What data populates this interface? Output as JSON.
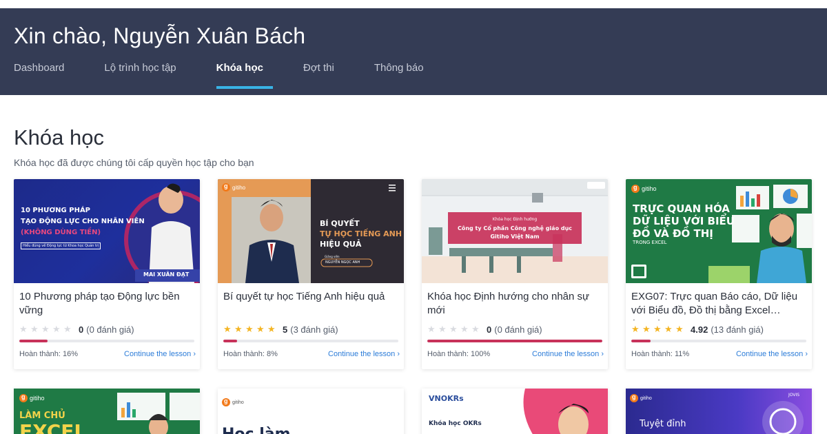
{
  "header": {
    "greeting": "Xin chào, Nguyễn Xuân Bách",
    "tabs": [
      {
        "label": "Dashboard",
        "active": false
      },
      {
        "label": "Lộ trình học tập",
        "active": false
      },
      {
        "label": "Khóa học",
        "active": true
      },
      {
        "label": "Đợt thi",
        "active": false
      },
      {
        "label": "Thông báo",
        "active": false
      }
    ]
  },
  "page": {
    "title": "Khóa học",
    "subtitle": "Khóa học đã được chúng tôi cấp quyền học tập cho bạn"
  },
  "colors": {
    "header_bg": "#343c55",
    "tab_underline": "#39b3e5",
    "progress": "#c8325a",
    "link": "#2a7bd8",
    "star": "#f4b524"
  },
  "courses": [
    {
      "title": "10 Phương pháp tạo Động lực bền vững",
      "score": "0",
      "count": "(0 đánh giá)",
      "stars_filled": 0,
      "progress_label": "Hoàn thành: 16%",
      "progress": 16,
      "cta": "Continue the lesson",
      "thumb": {
        "line1": "10 PHƯƠNG PHÁP",
        "line2": "TẠO ĐỘNG LỰC CHO NHÂN VIÊN",
        "line3": "(KHÔNG DÙNG TIỀN)",
        "line4": "Hiểu đúng về Động lực từ Khoa học Quản trị",
        "author": "MAI XUÂN ĐẠT"
      }
    },
    {
      "title": "Bí quyết tự học Tiếng Anh hiệu quả",
      "score": "5",
      "count": "(3 đánh giá)",
      "stars_filled": 5,
      "progress_label": "Hoàn thành: 8%",
      "progress": 8,
      "cta": "Continue the lesson",
      "thumb": {
        "logo": "gitiho",
        "line1": "BÍ QUYẾT",
        "line2": "TỰ HỌC TIẾNG ANH",
        "line3": "HIỆU QUẢ",
        "role": "Giảng viên",
        "author": "NGUYỄN NGỌC ANH"
      }
    },
    {
      "title": "Khóa học Định hướng cho nhân sự mới",
      "score": "0",
      "count": "(0 đánh giá)",
      "stars_filled": 0,
      "progress_label": "Hoàn thành: 100%",
      "progress": 100,
      "cta": "Continue the lesson",
      "thumb": {
        "line1": "Khóa học Định hướng",
        "line2": "Công ty Cổ phần Công nghệ giáo dục",
        "line3": "Gitiho Việt Nam"
      }
    },
    {
      "title": "EXG07: Trực quan Báo cáo, Dữ liệu với Biểu đồ, Đồ thị bằng Excel (Excel...",
      "score": "4.92",
      "count": "(13 đánh giá)",
      "stars_filled": 5,
      "progress_label": "Hoàn thành: 11%",
      "progress": 11,
      "cta": "Continue the lesson",
      "thumb": {
        "logo": "gitiho",
        "line1": "TRỰC QUAN HÓA",
        "line2": "DỮ LIỆU VỚI BIỂU",
        "line3": "ĐỒ VÀ ĐỒ THỊ",
        "line4": "TRONG EXCEL"
      }
    }
  ],
  "courses_row2": [
    {
      "logo": "gitiho",
      "line1": "LÀM CHỦ",
      "line2": "EXCEL"
    },
    {
      "logo": "gitiho",
      "line1": "Học làm"
    },
    {
      "logo": "VNOKRs",
      "line1": "Khóa học OKRs"
    },
    {
      "logo": "gitiho",
      "line1": "Tuyệt đỉnh",
      "badge": "JOVIS"
    }
  ]
}
